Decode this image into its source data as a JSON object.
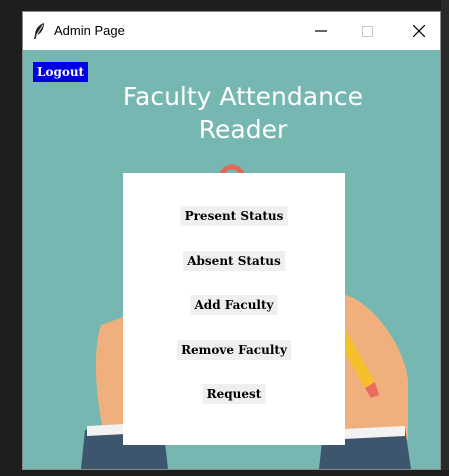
{
  "window": {
    "title": "Admin Page",
    "icons": {
      "app": "feather-icon",
      "minimize": "minimize-icon",
      "maximize": "maximize-icon",
      "close": "close-icon"
    }
  },
  "content": {
    "logout_label": "Logout",
    "heading_line1": "Faculty Attendance",
    "heading_line2": "Reader",
    "buttons": [
      {
        "label": "Present Status"
      },
      {
        "label": "Absent Status"
      },
      {
        "label": "Add Faculty"
      },
      {
        "label": "Remove Faculty"
      },
      {
        "label": "Request"
      }
    ]
  },
  "colors": {
    "background": "#76b7b2",
    "logout_bg": "#0000e6",
    "button_bg": "#efefef",
    "heading_text": "#ffffff"
  }
}
